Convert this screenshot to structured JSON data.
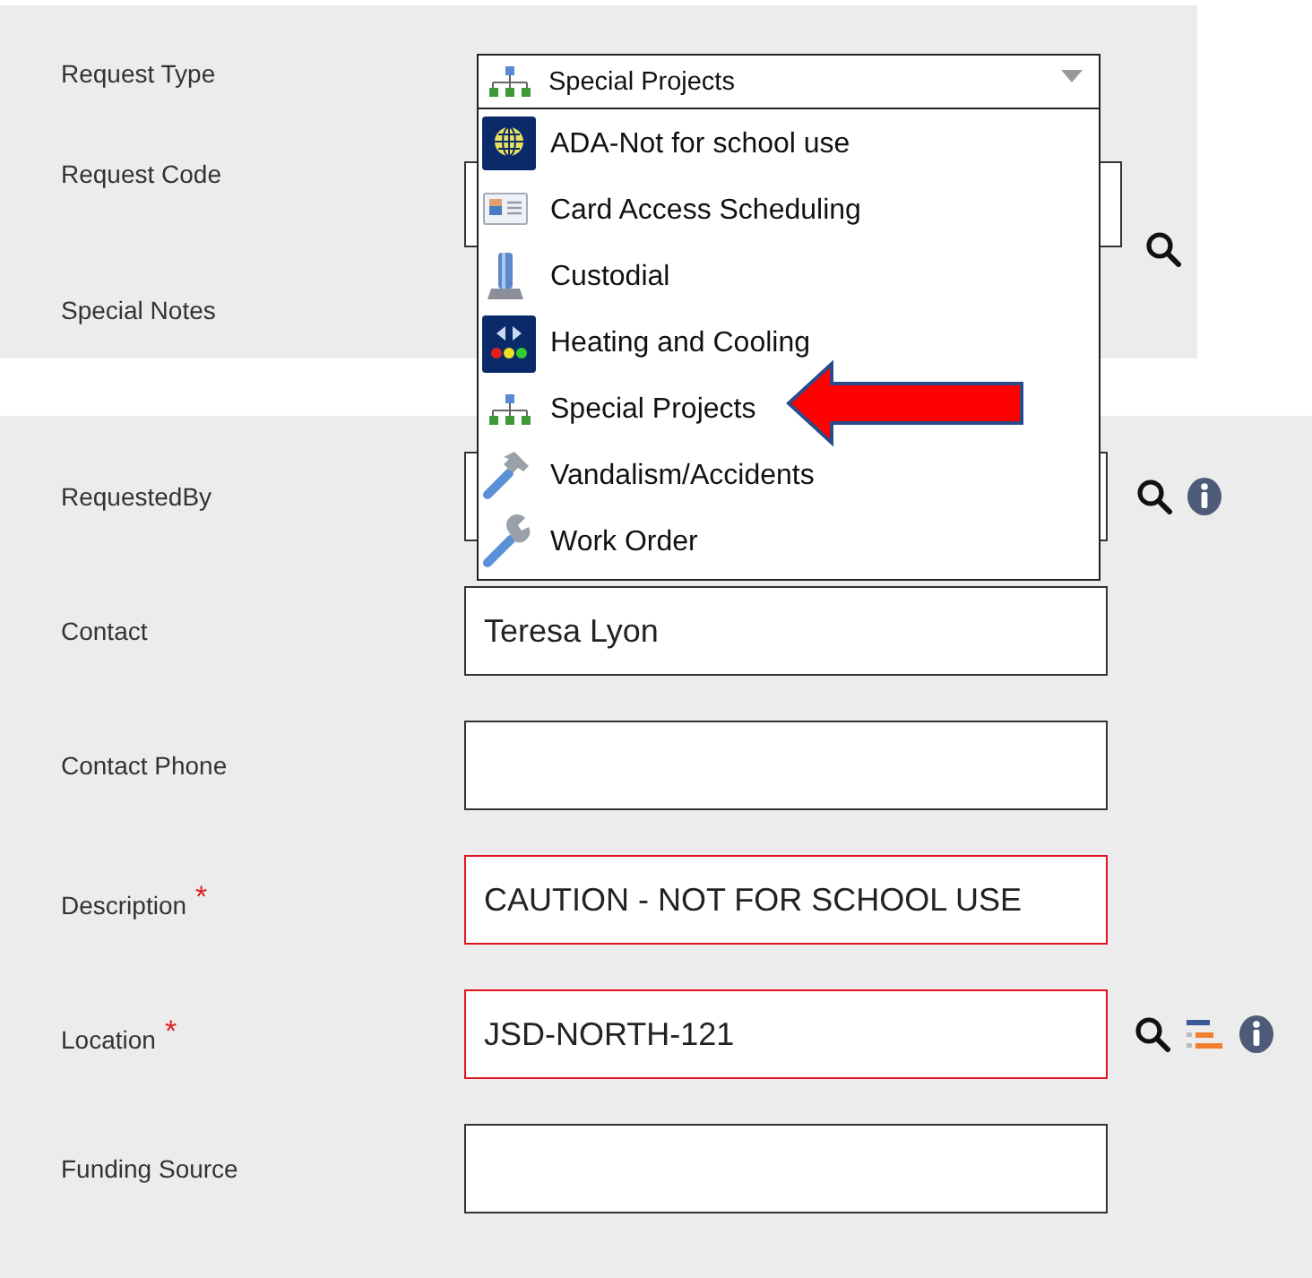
{
  "top_section": {
    "fields": [
      {
        "label": "Request Type",
        "kind": "select"
      },
      {
        "label": "Request Code",
        "kind": "lookup",
        "invalid": false
      },
      {
        "label": "Special Notes",
        "kind": "label_only"
      }
    ]
  },
  "request_type_dropdown": {
    "value": "Special Projects",
    "expanded": true,
    "options": [
      {
        "label": "ADA-Not for school use",
        "arrow_callout": false
      },
      {
        "label": "Card Access Scheduling",
        "arrow_callout": false
      },
      {
        "label": "Custodial",
        "arrow_callout": false
      },
      {
        "label": "Heating and Cooling",
        "arrow_callout": false
      },
      {
        "label": "Special Projects",
        "arrow_callout": true
      },
      {
        "label": "Vandalism/Accidents",
        "arrow_callout": false
      },
      {
        "label": "Work Order",
        "arrow_callout": false
      }
    ]
  },
  "bottom_section": {
    "fields": [
      {
        "label": "RequestedBy",
        "kind": "lookup_info",
        "invalid": false
      },
      {
        "label": "Contact",
        "kind": "text",
        "value": "Teresa Lyon",
        "invalid": false
      },
      {
        "label": "Contact Phone",
        "kind": "text",
        "invalid": false
      },
      {
        "label": "Description",
        "kind": "text",
        "value": "CAUTION - NOT FOR SCHOOL USE",
        "invalid": true,
        "required_mark": "*"
      },
      {
        "label": "Location",
        "kind": "location",
        "value": "JSD-NORTH-121",
        "invalid": true,
        "required_mark": "*"
      },
      {
        "label": "Funding Source",
        "kind": "text",
        "invalid": false
      }
    ]
  }
}
